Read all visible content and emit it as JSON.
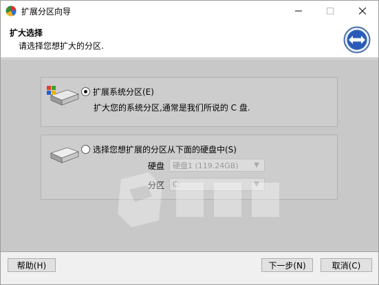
{
  "window": {
    "title": "扩展分区向导",
    "app_icon": "partition-app-icon"
  },
  "header": {
    "title": "扩大选择",
    "subtitle": "请选择您想扩大的分区.",
    "nav_icon": "double-arrow-icon"
  },
  "options": {
    "system": {
      "label": "扩展系统分区(E)",
      "description": "扩大您的系统分区,通常是我们所说的 C 盘.",
      "selected": true,
      "icon": "system-drive-icon"
    },
    "other": {
      "label": "选择您想扩展的分区从下面的硬盘中(S)",
      "selected": false,
      "icon": "hard-drive-icon",
      "disk_label": "硬盘",
      "disk_value": "硬盘1 (119.24GB)",
      "partition_label": "分区",
      "partition_value": "C:"
    }
  },
  "footer": {
    "help_label": "帮助(H)",
    "next_label": "下一步(N)",
    "cancel_label": "取消(C)"
  },
  "colors": {
    "content_bg": "#c8c8c8",
    "header_bg": "#ffffff",
    "accent": "#1f5fbf"
  }
}
